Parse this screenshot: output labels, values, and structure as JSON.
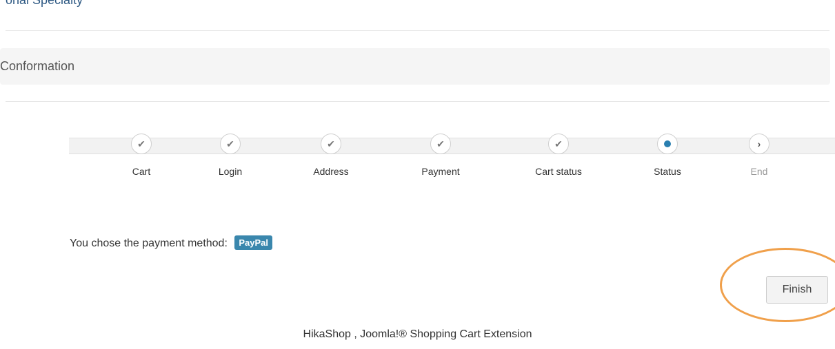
{
  "page": {
    "top_heading": "onal Specialty",
    "section_title": "Conformation"
  },
  "checkout_steps": [
    {
      "label": "Cart",
      "state": "done",
      "icon": "check-icon"
    },
    {
      "label": "Login",
      "state": "done",
      "icon": "check-icon"
    },
    {
      "label": "Address",
      "state": "done",
      "icon": "check-icon"
    },
    {
      "label": "Payment",
      "state": "done",
      "icon": "check-icon"
    },
    {
      "label": "Cart status",
      "state": "done",
      "icon": "check-icon"
    },
    {
      "label": "Status",
      "state": "current",
      "icon": "current-dot-icon"
    },
    {
      "label": "End",
      "state": "pending",
      "icon": "chevron-right-icon"
    }
  ],
  "payment": {
    "message": "You chose the payment method:",
    "method": "PayPal"
  },
  "actions": {
    "finish_label": "Finish"
  },
  "footer": {
    "text": "HikaShop , Joomla!® Shopping Cart Extension"
  },
  "colors": {
    "accent": "#3a87ad",
    "current_step": "#2a7fb0",
    "highlight_ring": "#f0a04b"
  }
}
